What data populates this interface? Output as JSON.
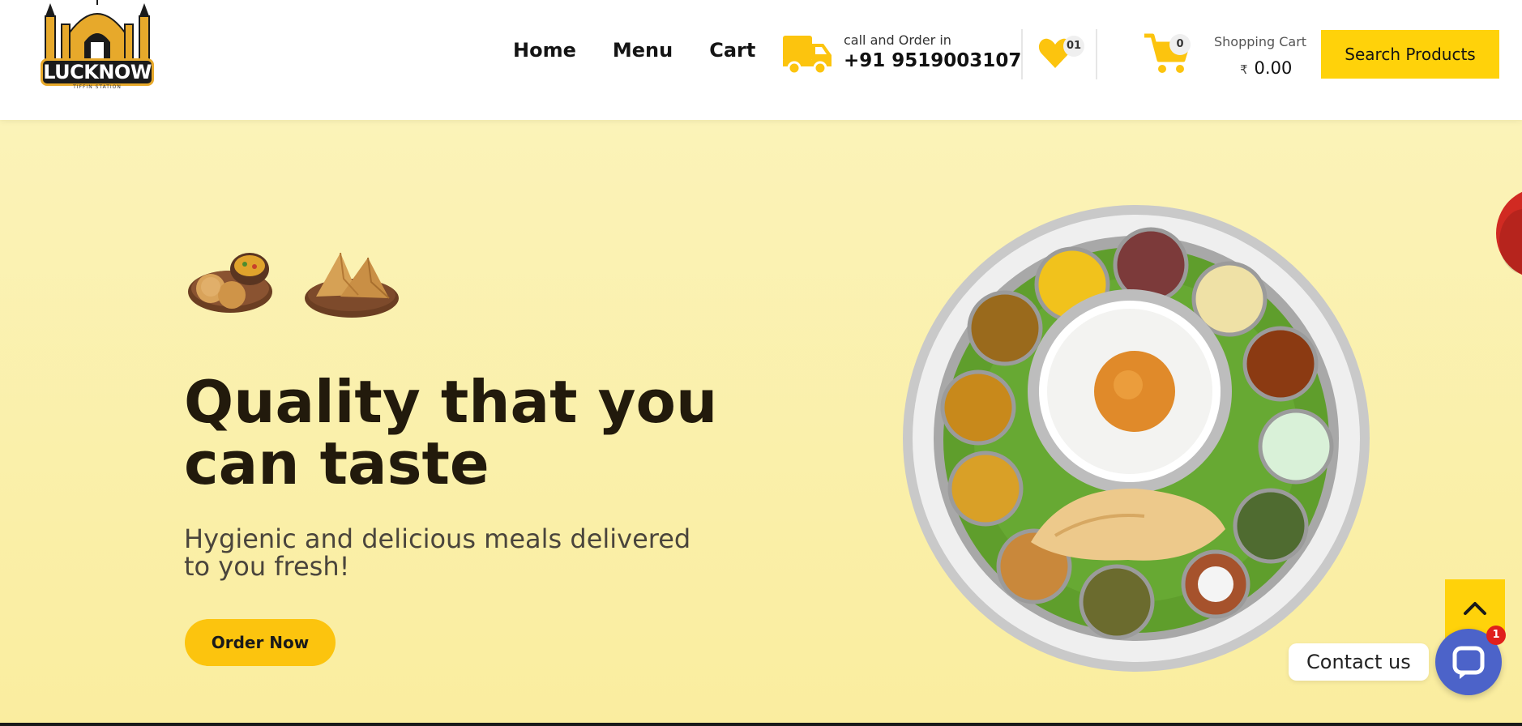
{
  "header": {
    "logo": {
      "word": "LUCKNOW",
      "tagline": "TIFFIN STATION"
    },
    "nav": [
      {
        "label": "Home"
      },
      {
        "label": "Menu"
      },
      {
        "label": "Cart"
      }
    ],
    "contact": {
      "label": "call and Order in",
      "phone": "+91 9519003107"
    },
    "wishlist": {
      "count": "01"
    },
    "cart": {
      "count": "0",
      "label": "Shopping Cart",
      "currency": "₹",
      "total": "0.00"
    },
    "search_button": "Search Products"
  },
  "hero": {
    "title_line1": "Quality that you",
    "title_line2": "can taste",
    "subtitle_line1": "Hygienic and delicious meals delivered",
    "subtitle_line2": "to you fresh!",
    "cta": "Order Now"
  },
  "floating": {
    "contact_label": "Contact us",
    "notification_count": "1",
    "scroll_top_icon": "chevron-up-icon"
  },
  "colors": {
    "accent": "#ffd20a",
    "cta": "#fcc40e",
    "hero_bg": "#fbf3b8",
    "contact_button": "#4c63c9"
  }
}
